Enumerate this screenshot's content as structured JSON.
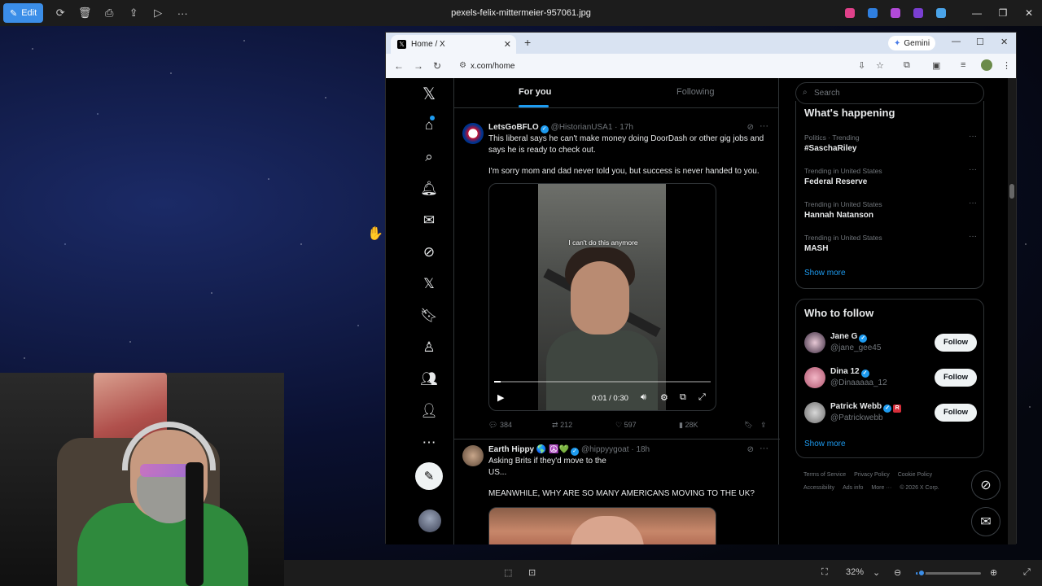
{
  "viewer": {
    "edit_label": "Edit",
    "file_title": "pexels-felix-mittermeier-957061.jpg",
    "zoom": "32%"
  },
  "browser": {
    "tab_title": "Home / X",
    "url": "x.com/home",
    "gemini_label": "Gemini"
  },
  "timeline": {
    "tabs": [
      "For you",
      "Following"
    ],
    "tweet1": {
      "name": "LetsGoBFLO",
      "handle": "@HistorianUSA1 · 17h",
      "text1": "This liberal says he can't make money doing DoorDash or other gig jobs and says he is ready to check out.",
      "text2": "I'm sorry mom and dad never told you, but success is never handed to you.",
      "video_caption": "I can't do this anymore",
      "video_time": "0:01 / 0:30",
      "video_progress": 0.03,
      "replies": "384",
      "reposts": "212",
      "likes": "597",
      "views": "28K"
    },
    "tweet2": {
      "name": "Earth Hippy 🌎 ☮️💚",
      "handle": "@hippyygoat · 18h",
      "text1": "Asking Brits if they'd move to the US...",
      "text2": "MEANWHILE, WHY ARE SO MANY AMERICANS MOVING TO THE UK?"
    }
  },
  "sidebar": {
    "search_placeholder": "Search",
    "whats_happening_title": "What's happening",
    "trends": [
      {
        "category": "Politics · Trending",
        "name": "#SaschaRiley"
      },
      {
        "category": "Trending in United States",
        "name": "Federal Reserve"
      },
      {
        "category": "Trending in United States",
        "name": "Hannah Natanson"
      },
      {
        "category": "Trending in United States",
        "name": "MASH"
      }
    ],
    "show_more": "Show more",
    "who_to_follow_title": "Who to follow",
    "follow_suggestions": [
      {
        "name": "Jane G",
        "handle": "@jane_gee45",
        "button": "Follow"
      },
      {
        "name": "Dina 12",
        "handle": "@Dinaaaaa_12",
        "button": "Follow"
      },
      {
        "name": "Patrick Webb",
        "handle": "@Patrickwebb",
        "button": "Follow"
      }
    ],
    "show_more_2": "Show more",
    "footer": [
      "Terms of Service",
      "Privacy Policy",
      "Cookie Policy",
      "Accessibility",
      "Ads info",
      "More ···",
      "© 2026 X Corp."
    ]
  }
}
